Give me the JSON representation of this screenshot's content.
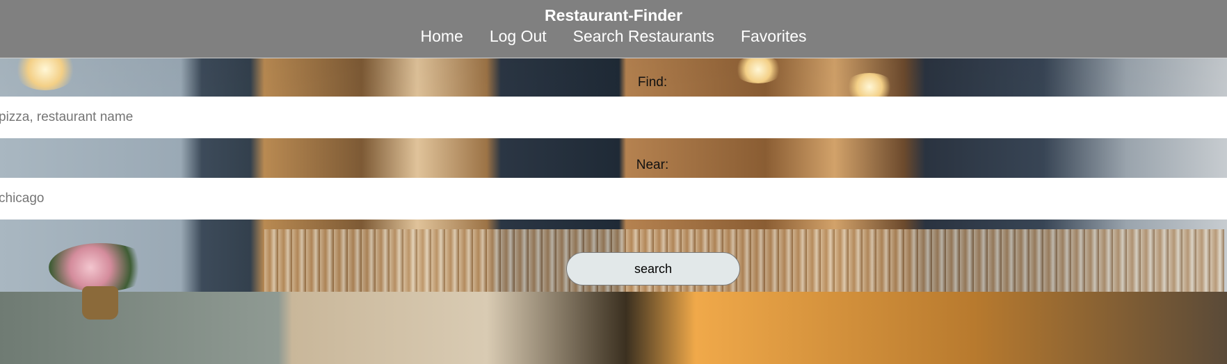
{
  "header": {
    "title": "Restaurant-Finder",
    "nav": [
      {
        "label": "Home"
      },
      {
        "label": "Log Out"
      },
      {
        "label": "Search Restaurants"
      },
      {
        "label": "Favorites"
      }
    ]
  },
  "search": {
    "find_label": "Find:",
    "find_placeholder": "pizza, restaurant name",
    "find_value": "",
    "near_label": "Near:",
    "near_placeholder": "chicago",
    "near_value": "",
    "button_label": "search"
  },
  "colors": {
    "header_bg": "#808080",
    "header_text": "#ffffff",
    "button_bg": "#e2e8e9",
    "input_bg": "#ffffff"
  }
}
